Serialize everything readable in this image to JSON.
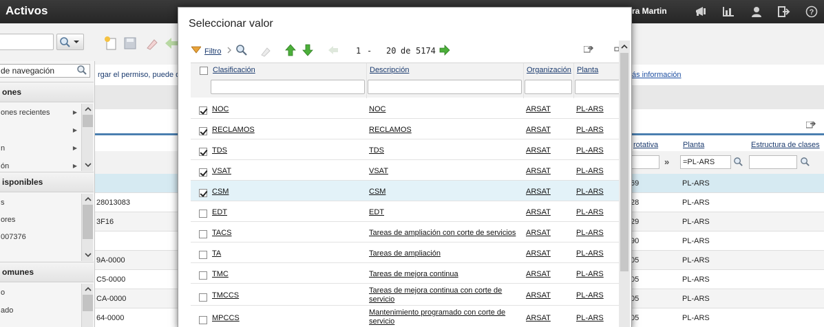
{
  "app": {
    "title": "Activos",
    "user_name": "ra Martin",
    "top_icons": [
      "megaphone-icon",
      "report-chart-icon",
      "user-icon",
      "logout-icon",
      "help-icon"
    ]
  },
  "background": {
    "nav_search_value": "de navegación",
    "nav_sections": [
      {
        "title": "ones",
        "items": [
          "ones recientes",
          "",
          "n",
          "ón"
        ]
      },
      {
        "title": "isponibles",
        "items": [
          "s",
          "ores",
          "007376"
        ]
      },
      {
        "title": "omunes",
        "items": [
          "o",
          "ado"
        ]
      }
    ],
    "info_text": "rgar el permiso, puede q",
    "info_link": "ás información",
    "columns": [
      "rotativa",
      "Planta",
      "Estructura de clases"
    ],
    "filter_planta": "=PL-ARS",
    "rows": [
      {
        "code": "",
        "rot": "69",
        "planta": "PL-ARS"
      },
      {
        "code": "28013083",
        "rot": "28",
        "planta": "PL-ARS"
      },
      {
        "code": "3F16",
        "rot": "29",
        "planta": "PL-ARS"
      },
      {
        "code": "",
        "rot": "90",
        "planta": "PL-ARS"
      },
      {
        "code": "9A-0000",
        "rot": "05",
        "planta": "PL-ARS"
      },
      {
        "code": "C5-0000",
        "rot": "05",
        "planta": "PL-ARS"
      },
      {
        "code": "CA-0000",
        "rot": "05",
        "planta": "PL-ARS"
      },
      {
        "code": "64-0000",
        "rot": "05",
        "planta": "PL-ARS"
      }
    ]
  },
  "modal": {
    "title": "Seleccionar valor",
    "filter_label": "Filtro",
    "pager": {
      "start": "1",
      "sep": "-",
      "end": "20",
      "of_label": "de",
      "total": "5174"
    },
    "columns": {
      "clasificacion": "Clasificación",
      "descripcion": "Descripción",
      "organizacion": "Organización",
      "planta": "Planta"
    },
    "rows": [
      {
        "checked": true,
        "clas": "NOC",
        "desc": "NOC",
        "org": "ARSAT",
        "planta": "PL-ARS"
      },
      {
        "checked": true,
        "clas": "RECLAMOS",
        "desc": "RECLAMOS",
        "org": "ARSAT",
        "planta": "PL-ARS"
      },
      {
        "checked": true,
        "clas": "TDS",
        "desc": "TDS",
        "org": "ARSAT",
        "planta": "PL-ARS"
      },
      {
        "checked": true,
        "clas": "VSAT",
        "desc": "VSAT",
        "org": "ARSAT",
        "planta": "PL-ARS"
      },
      {
        "checked": true,
        "clas": "CSM",
        "desc": "CSM",
        "org": "ARSAT",
        "planta": "PL-ARS",
        "selected": true
      },
      {
        "checked": false,
        "clas": "EDT",
        "desc": "EDT",
        "org": "ARSAT",
        "planta": "PL-ARS"
      },
      {
        "checked": false,
        "clas": "TACS",
        "desc": "Tareas de ampliación con corte de servicios",
        "org": "ARSAT",
        "planta": "PL-ARS"
      },
      {
        "checked": false,
        "clas": "TA",
        "desc": "Tareas de ampliación",
        "org": "ARSAT",
        "planta": "PL-ARS"
      },
      {
        "checked": false,
        "clas": "TMC",
        "desc": "Tareas de mejora continua",
        "org": "ARSAT",
        "planta": "PL-ARS"
      },
      {
        "checked": false,
        "clas": "TMCCS",
        "desc": "Tareas de mejora continua con corte de servicio",
        "org": "ARSAT",
        "planta": "PL-ARS"
      },
      {
        "checked": false,
        "clas": "MPCCS",
        "desc": "Mantenimiento programado con corte de servicio",
        "org": "ARSAT",
        "planta": "PL-ARS"
      }
    ]
  }
}
